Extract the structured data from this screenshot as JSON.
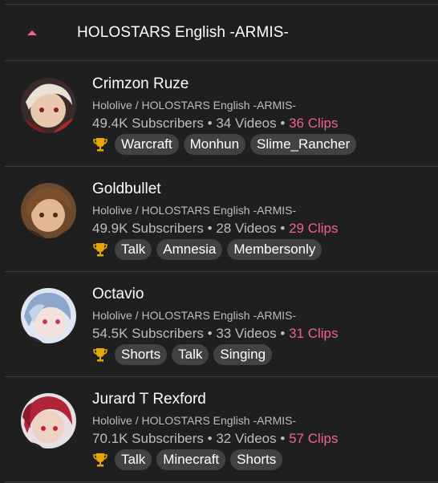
{
  "group": {
    "title": "HOLOSTARS English -ARMIS-",
    "caret_icon": "caret-up-icon",
    "accent": "#f06292"
  },
  "channels": [
    {
      "name": "Crimzon Ruze",
      "org": "Hololive / HOLOSTARS English -ARMIS-",
      "subscribers": "49.4K Subscribers",
      "videos": "34 Videos",
      "clips": "36 Clips",
      "tags": [
        "Warcraft",
        "Monhun",
        "Slime_Rancher"
      ]
    },
    {
      "name": "Goldbullet",
      "org": "Hololive / HOLOSTARS English -ARMIS-",
      "subscribers": "49.9K Subscribers",
      "videos": "28 Videos",
      "clips": "29 Clips",
      "tags": [
        "Talk",
        "Amnesia",
        "Membersonly"
      ]
    },
    {
      "name": "Octavio",
      "org": "Hololive / HOLOSTARS English -ARMIS-",
      "subscribers": "54.5K Subscribers",
      "videos": "33 Videos",
      "clips": "31 Clips",
      "tags": [
        "Shorts",
        "Talk",
        "Singing"
      ]
    },
    {
      "name": "Jurard T Rexford",
      "org": "Hololive / HOLOSTARS English -ARMIS-",
      "subscribers": "70.1K Subscribers",
      "videos": "32 Videos",
      "clips": "57 Clips",
      "tags": [
        "Talk",
        "Minecraft",
        "Shorts"
      ]
    }
  ],
  "separator": "•",
  "icons": {
    "trophy": "trophy-icon"
  },
  "colors": {
    "background": "#1f1f1f",
    "tag_bg": "#424242",
    "clips": "#f06292",
    "trophy": "#e6a800"
  }
}
